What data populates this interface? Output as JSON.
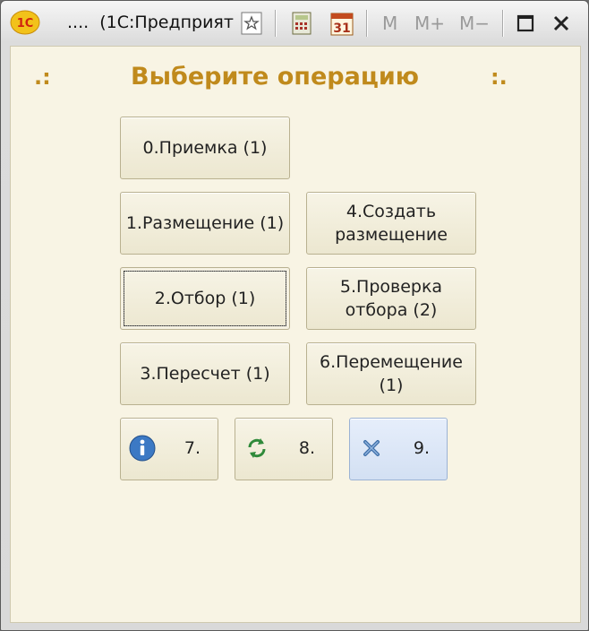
{
  "window": {
    "title": "....  (1С:Предприят",
    "memory_buttons": [
      "M",
      "M+",
      "M−"
    ],
    "calendar_day": "31",
    "logo_text": "1С"
  },
  "screen": {
    "heading": "Выберите операцию",
    "deco_left": ".:",
    "deco_right": ":."
  },
  "operations": [
    {
      "line1": "0.Приемка (1)",
      "line2": ""
    },
    {
      "line1": "1.Размещение (1)",
      "line2": ""
    },
    {
      "line1": "2.Отбор (1)",
      "line2": ""
    },
    {
      "line1": "3.Пересчет (1)",
      "line2": ""
    },
    {
      "line1": "4.Создать",
      "line2": "размещение"
    },
    {
      "line1": "5.Проверка",
      "line2": "отбора (2)"
    },
    {
      "line1": "6.Перемещение",
      "line2": "(1)"
    }
  ],
  "service_buttons": [
    {
      "label": "7.",
      "icon": "info-icon"
    },
    {
      "label": "8.",
      "icon": "refresh-icon"
    },
    {
      "label": "9.",
      "icon": "close-x-icon"
    }
  ],
  "colors": {
    "heading": "#c08a1c",
    "panel": "#f8f4e4",
    "button_face": "#f1edda",
    "active_button": "#dbe6f6"
  }
}
